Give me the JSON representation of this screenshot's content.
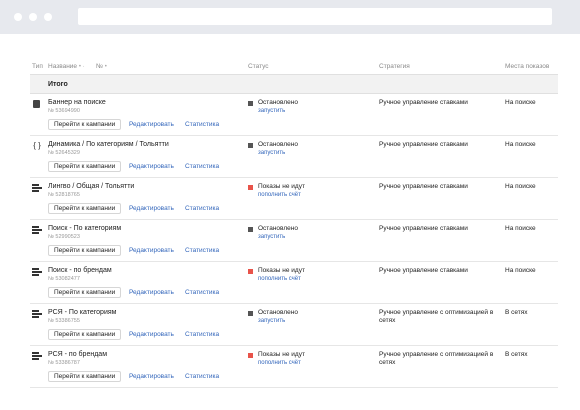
{
  "table": {
    "headers": {
      "type": "Тип",
      "name": "Название",
      "name_sort": "•",
      "dash": "·",
      "number": "№",
      "number_sort": "•",
      "status": "Статус",
      "strategy": "Стратегия",
      "places": "Места показов"
    },
    "total_label": "Итого",
    "rows": [
      {
        "icon": "banner-icon",
        "name": "Баннер на поиске",
        "number": "№ 53694990",
        "goto_label": "Перейти к кампании",
        "edit_label": "Редактировать",
        "stats_label": "Статистика",
        "status_color": "#555555",
        "status": "Остановлено",
        "status_action": "запустить",
        "strategy": "Ручное управление ставками",
        "places": "На поиске"
      },
      {
        "icon": "dynamic-braces-icon",
        "icon_glyph": "{ }",
        "name": "Динамика / По категориям / Тольятти",
        "number": "№ 52645329",
        "goto_label": "Перейти к кампании",
        "edit_label": "Редактировать",
        "stats_label": "Статистика",
        "status_color": "#555555",
        "status": "Остановлено",
        "status_action": "запустить",
        "strategy": "Ручное управление ставками",
        "places": "На поиске"
      },
      {
        "icon": "text-ad-icon",
        "name": "Лингво / Общая / Тольятти",
        "number": "№ 52818765",
        "goto_label": "Перейти к кампании",
        "edit_label": "Редактировать",
        "stats_label": "Статистика",
        "status_color": "#e8534a",
        "status": "Показы не идут",
        "status_action": "пополнить счёт",
        "strategy": "Ручное управление ставками",
        "places": "На поиске"
      },
      {
        "icon": "text-ad-icon",
        "name": "Поиск - По категориям",
        "number": "№ 52990523",
        "goto_label": "Перейти к кампании",
        "edit_label": "Редактировать",
        "stats_label": "Статистика",
        "status_color": "#555555",
        "status": "Остановлено",
        "status_action": "запустить",
        "strategy": "Ручное управление ставками",
        "places": "На поиске"
      },
      {
        "icon": "text-ad-icon",
        "name": "Поиск - по брендам",
        "number": "№ 53082477",
        "goto_label": "Перейти к кампании",
        "edit_label": "Редактировать",
        "stats_label": "Статистика",
        "status_color": "#e8534a",
        "status": "Показы не идут",
        "status_action": "пополнить счёт",
        "strategy": "Ручное управление ставками",
        "places": "На поиске"
      },
      {
        "icon": "text-ad-icon",
        "name": "РСЯ - По категориям",
        "number": "№ 53386755",
        "goto_label": "Перейти к кампании",
        "edit_label": "Редактировать",
        "stats_label": "Статистика",
        "status_color": "#555555",
        "status": "Остановлено",
        "status_action": "запустить",
        "strategy": "Ручное управление с оптимизацией в сетях",
        "places": "В сетях"
      },
      {
        "icon": "text-ad-icon",
        "name": "РСЯ - по брендам",
        "number": "№ 53386787",
        "goto_label": "Перейти к кампании",
        "edit_label": "Редактировать",
        "stats_label": "Статистика",
        "status_color": "#e8534a",
        "status": "Показы не идут",
        "status_action": "пополнить счёт",
        "strategy": "Ручное управление с оптимизацией в сетях",
        "places": "В сетях"
      }
    ]
  }
}
